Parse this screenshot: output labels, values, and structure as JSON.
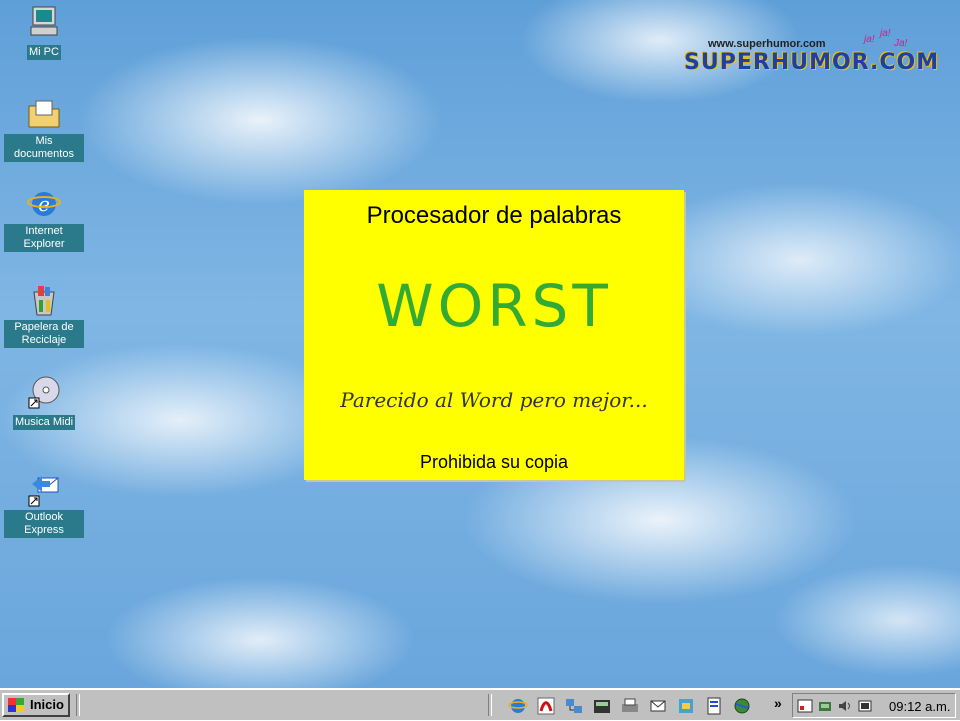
{
  "desktop_icons": [
    {
      "label": "Mi PC",
      "icon": "computer-icon"
    },
    {
      "label": "Mis documentos",
      "icon": "folder-icon"
    },
    {
      "label": "Internet Explorer",
      "icon": "ie-icon"
    },
    {
      "label": "Papelera de Reciclaje",
      "icon": "recycle-bin-icon"
    },
    {
      "label": "Musica Midi",
      "icon": "cd-icon"
    },
    {
      "label": "Outlook Express",
      "icon": "outlook-icon"
    }
  ],
  "logo": {
    "url": "www.superhumor.com",
    "name": "SUPERHUMOR.COM",
    "laughs": [
      "ja!",
      "ja!",
      "Ja!"
    ]
  },
  "card": {
    "title": "Procesador de palabras",
    "brand": "WORST",
    "tagline": "Parecido al Word pero mejor...",
    "footer": "Prohibida su copia",
    "bg_color": "#ffff00",
    "brand_color": "#33aa33"
  },
  "taskbar": {
    "start_label": "Inicio",
    "quick_launch": [
      "ie-icon",
      "acrobat-icon",
      "network-icon",
      "calculator-icon",
      "printer-icon",
      "mail-icon",
      "tools-icon",
      "word-icon",
      "globe-icon"
    ],
    "overflow": "»",
    "tray_icons": [
      "volume-settings-icon",
      "network-tray-icon",
      "speaker-icon",
      "battery-icon"
    ],
    "clock": "09:12 a.m."
  }
}
